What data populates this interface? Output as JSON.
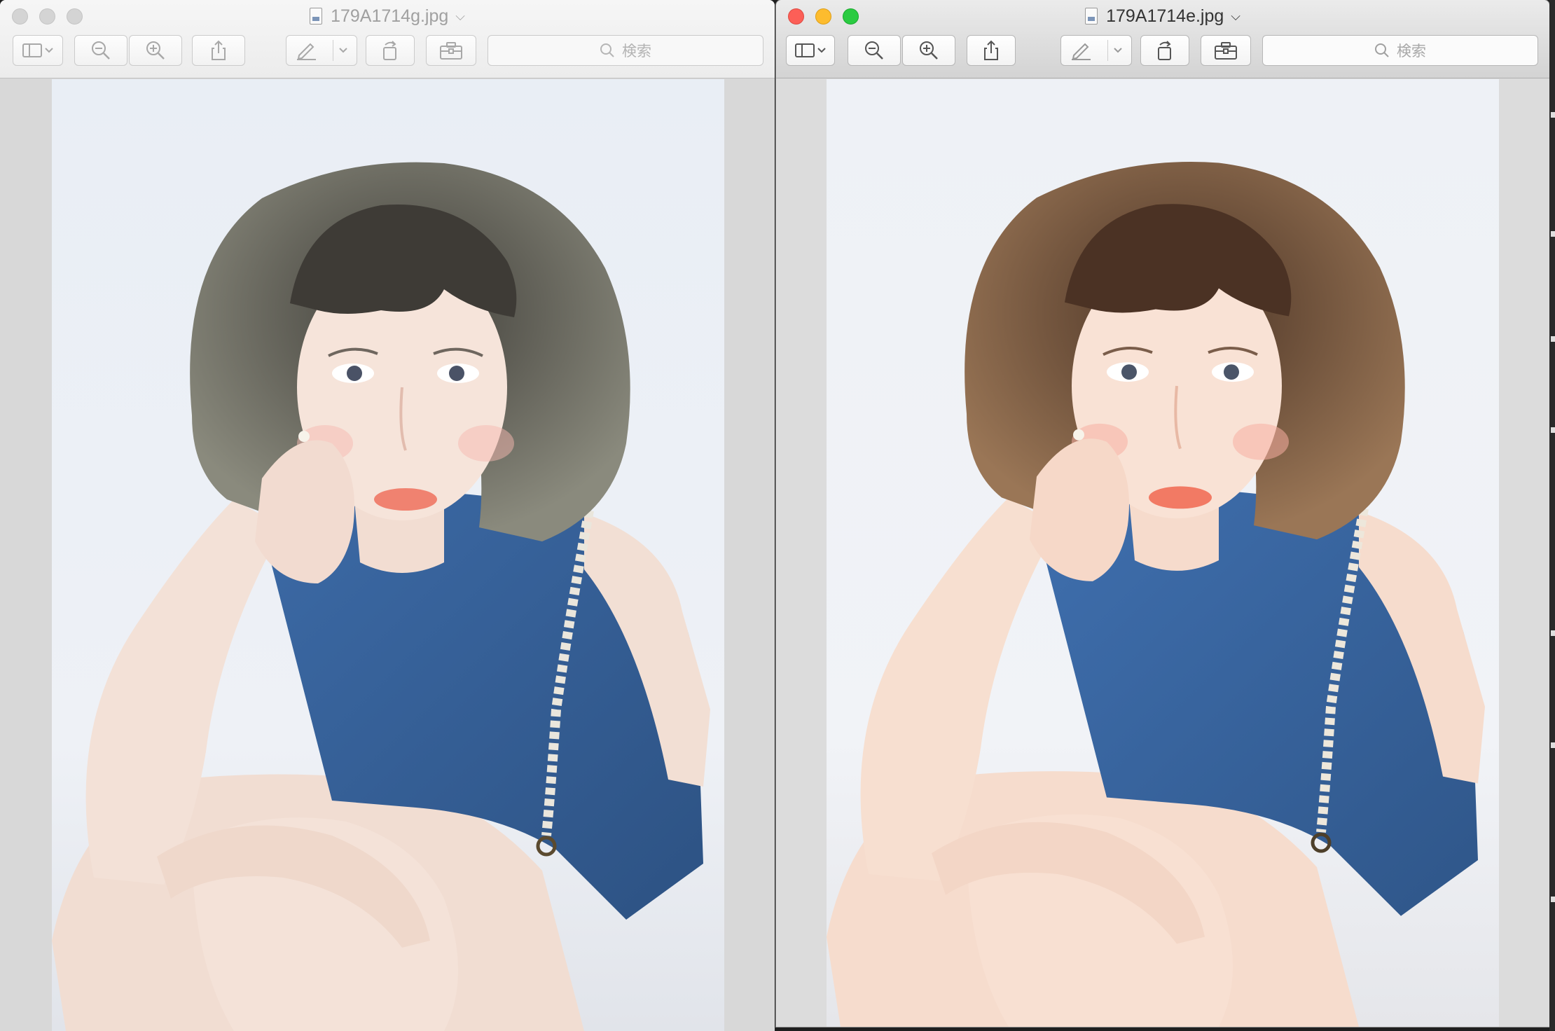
{
  "windows": {
    "left": {
      "title": "179A1714g.jpg",
      "search_placeholder": "検索",
      "active": false
    },
    "right": {
      "title": "179A1714e.jpg",
      "search_placeholder": "検索",
      "active": true
    }
  },
  "toolbar_icons": [
    "sidebar-icon",
    "chevron-down-icon",
    "zoom-out-icon",
    "zoom-in-icon",
    "share-icon",
    "markup-pen-icon",
    "chevron-down-icon",
    "rotate-icon",
    "toolbox-icon",
    "search-icon"
  ],
  "colors": {
    "close": "#fc5f57",
    "minimize": "#fdbc2e",
    "maximize": "#2acb41",
    "inactive_dot": "#d4d4d4"
  },
  "photo": {
    "subject": "portrait",
    "left_grade": "cool",
    "right_grade": "warm"
  }
}
